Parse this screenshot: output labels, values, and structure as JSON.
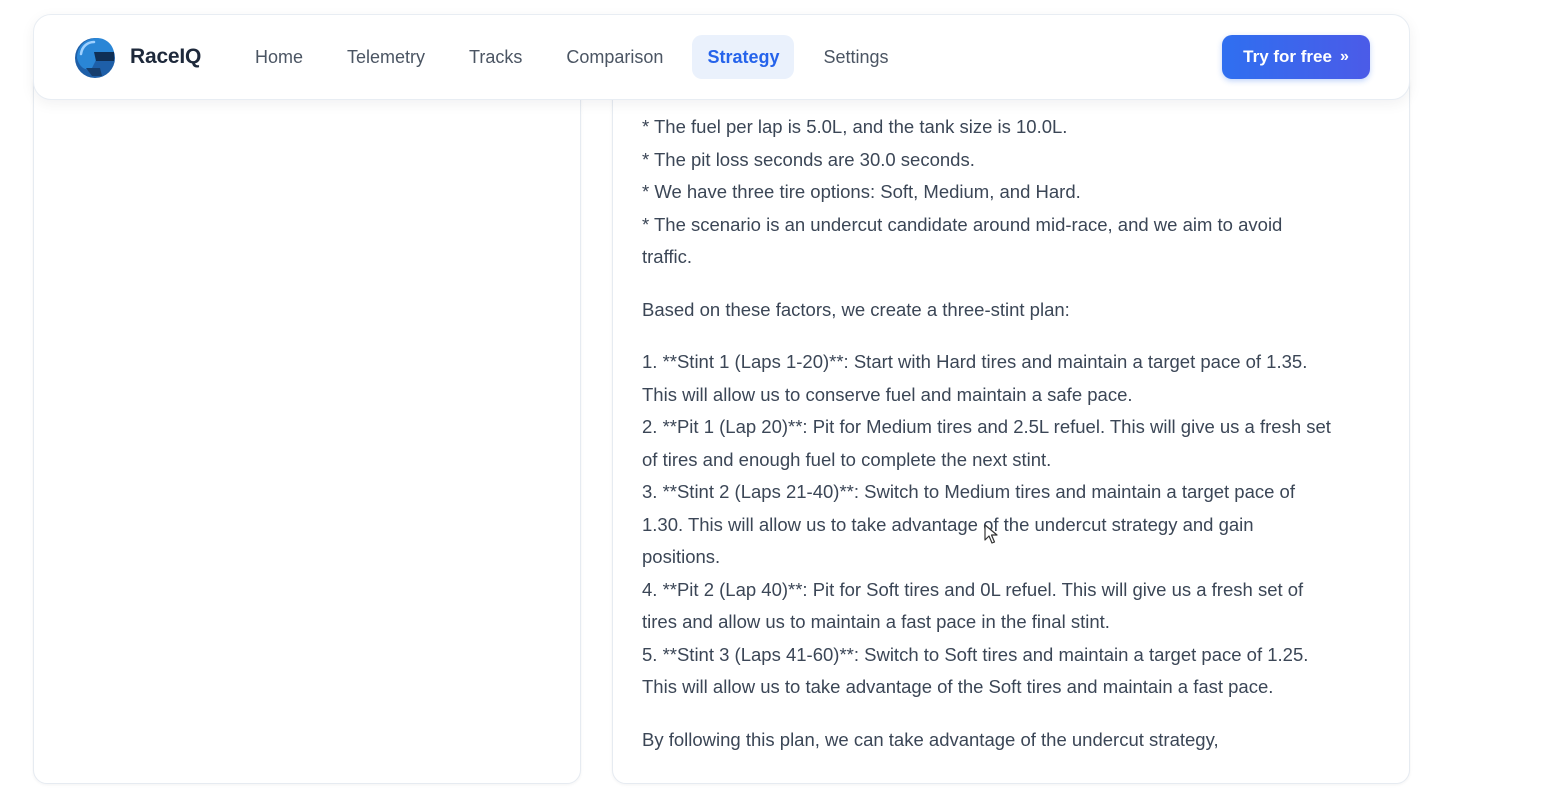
{
  "nav": {
    "brand": "RaceIQ",
    "links": [
      {
        "label": "Home",
        "active": false
      },
      {
        "label": "Telemetry",
        "active": false
      },
      {
        "label": "Tracks",
        "active": false
      },
      {
        "label": "Comparison",
        "active": false
      },
      {
        "label": "Strategy",
        "active": true
      },
      {
        "label": "Settings",
        "active": false
      }
    ],
    "cta_label": "Try for free",
    "cta_arrow": "»"
  },
  "response": {
    "bullets": [
      "* The fuel per lap is 5.0L, and the tank size is 10.0L.",
      "* The pit loss seconds are 30.0 seconds.",
      "* We have three tire options: Soft, Medium, and Hard.",
      "* The scenario is an undercut candidate around mid-race, and we aim to avoid",
      "traffic."
    ],
    "intro": "Based on these factors, we create a three-stint plan:",
    "plan_lines": [
      "1. **Stint 1 (Laps 1-20)**: Start with Hard tires and maintain a target pace of 1.35.",
      "This will allow us to conserve fuel and maintain a safe pace.",
      "2. **Pit 1 (Lap 20)**: Pit for Medium tires and 2.5L refuel. This will give us a fresh set",
      "of tires and enough fuel to complete the next stint.",
      "3. **Stint 2 (Laps 21-40)**: Switch to Medium tires and maintain a target pace of",
      "1.30. This will allow us to take advantage of the undercut strategy and gain",
      "positions.",
      "4. **Pit 2 (Lap 40)**: Pit for Soft tires and 0L refuel. This will give us a fresh set of",
      "tires and allow us to maintain a fast pace in the final stint.",
      "5. **Stint 3 (Laps 41-60)**: Switch to Soft tires and maintain a target pace of 1.25.",
      "This will allow us to take advantage of the Soft tires and maintain a fast pace."
    ],
    "closing": "By following this plan, we can take advantage of the undercut strategy,"
  },
  "colors": {
    "accent": "#2563eb",
    "active_bg": "#eaf1fc",
    "cta_start": "#2f6ff0",
    "cta_end": "#4b5be8",
    "text": "#3b4656"
  },
  "icons": {
    "logo": "helmet-logo-icon",
    "cursor": "mouse-pointer-icon"
  }
}
